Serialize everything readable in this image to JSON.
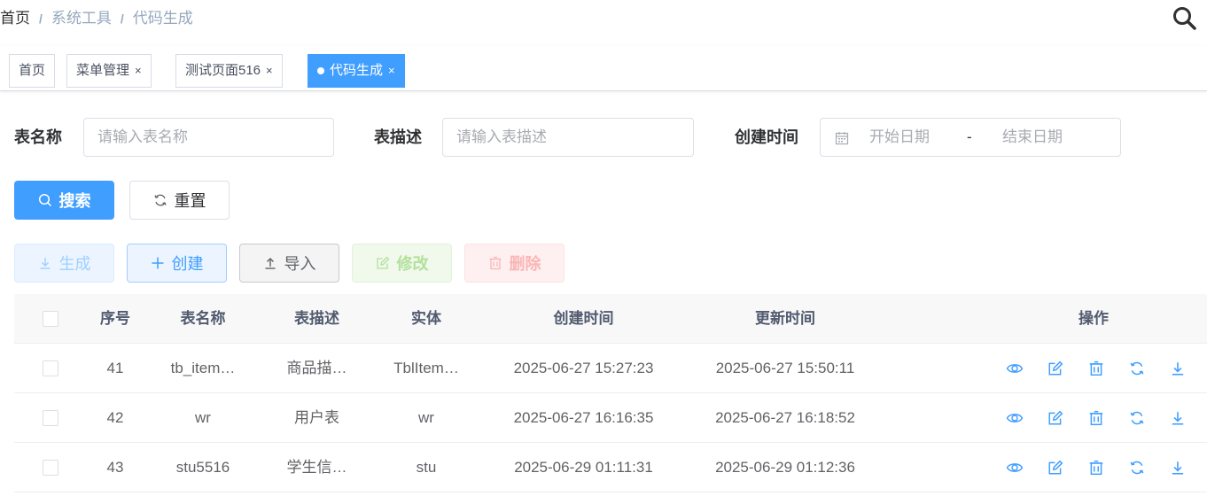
{
  "breadcrumb": {
    "home": "首页",
    "sep": "/",
    "items": [
      "系统工具",
      "代码生成"
    ]
  },
  "header": {
    "search_icon": "search-icon"
  },
  "tags": [
    {
      "label": "首页",
      "closable": false,
      "active": false
    },
    {
      "label": "菜单管理",
      "closable": true,
      "active": false
    },
    {
      "label": "测试页面516",
      "closable": true,
      "active": false
    },
    {
      "label": "代码生成",
      "closable": true,
      "active": true
    }
  ],
  "tag_close": "×",
  "query": {
    "table_name_label": "表名称",
    "table_name_placeholder": "请输入表名称",
    "table_desc_label": "表描述",
    "table_desc_placeholder": "请输入表描述",
    "create_time_label": "创建时间",
    "start_placeholder": "开始日期",
    "range_sep": "-",
    "end_placeholder": "结束日期",
    "search_label": "搜索",
    "reset_label": "重置"
  },
  "toolbar": {
    "generate_label": "生成",
    "create_label": "创建",
    "import_label": "导入",
    "edit_label": "修改",
    "delete_label": "删除"
  },
  "table": {
    "columns": [
      "序号",
      "表名称",
      "表描述",
      "实体",
      "创建时间",
      "更新时间",
      "操作"
    ],
    "rows": [
      {
        "index": "41",
        "table_name": "tb_item…",
        "table_desc": "商品描…",
        "entity": "TblItem…",
        "create_time": "2025-06-27 15:27:23",
        "update_time": "2025-06-27 15:50:11"
      },
      {
        "index": "42",
        "table_name": "wr",
        "table_desc": "用户表",
        "entity": "wr",
        "create_time": "2025-06-27 16:16:35",
        "update_time": "2025-06-27 16:18:52"
      },
      {
        "index": "43",
        "table_name": "stu5516",
        "table_desc": "学生信…",
        "entity": "stu",
        "create_time": "2025-06-29 01:11:31",
        "update_time": "2025-06-29 01:12:36"
      }
    ],
    "row_actions": [
      "preview-icon",
      "edit-icon",
      "delete-icon",
      "sync-icon",
      "download-icon"
    ]
  },
  "colors": {
    "primary": "#409eff",
    "breadcrumb_muted": "#97a8be",
    "header_bg": "#f8f8f9"
  }
}
